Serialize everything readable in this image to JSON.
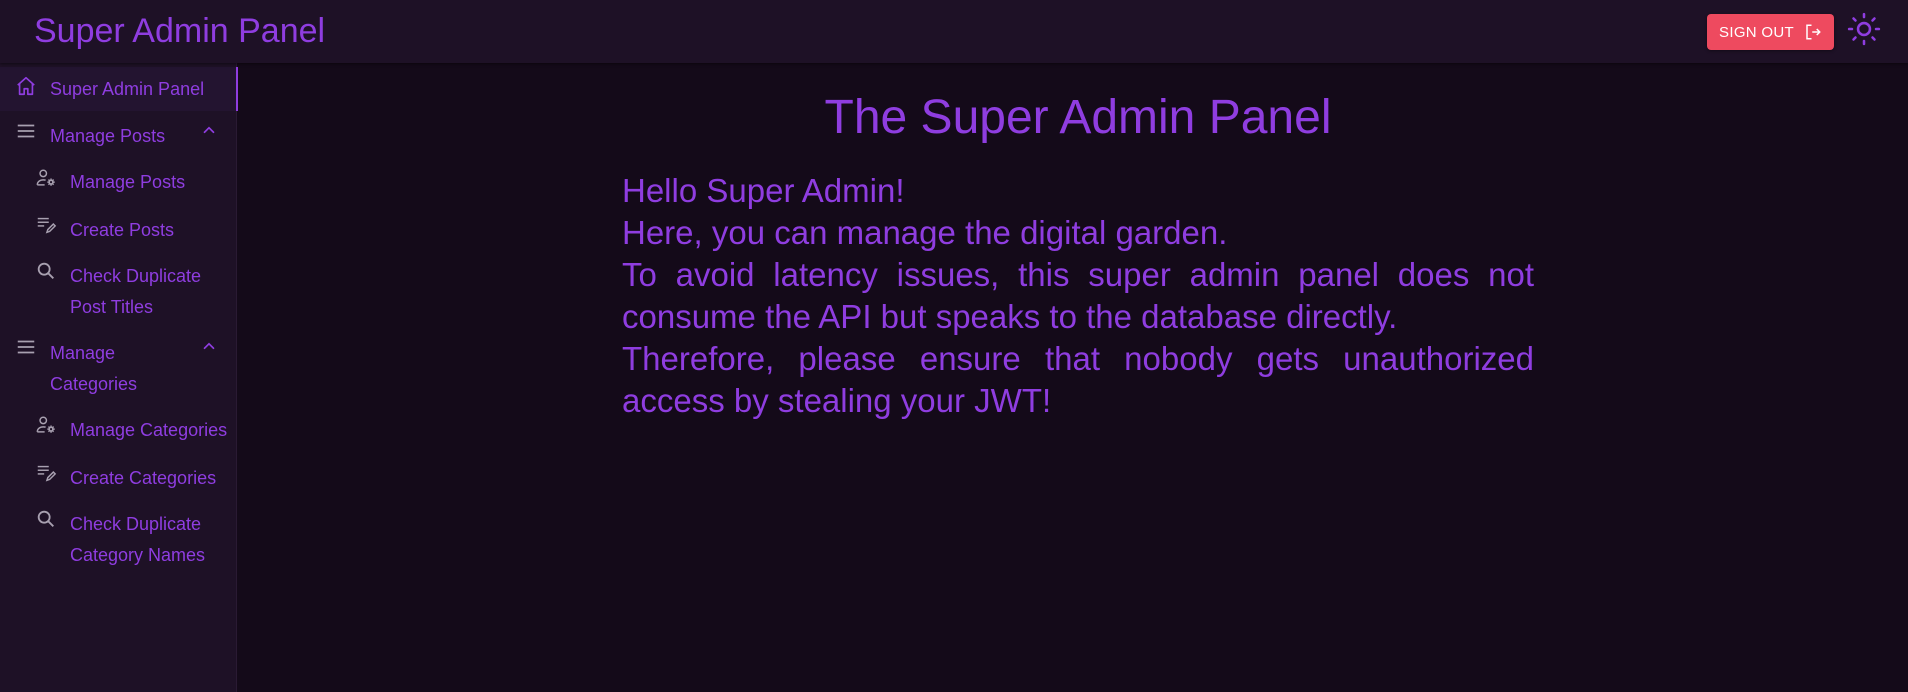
{
  "header": {
    "title": "Super Admin Panel",
    "signout_label": "SIGN OUT",
    "signout_icon": "logout-icon",
    "theme_icon": "sun-icon"
  },
  "sidebar": {
    "items": [
      {
        "label": "Super Admin Panel",
        "icon": "home-icon",
        "active": true
      },
      {
        "label": "Manage Posts",
        "icon": "menu-icon",
        "expanded": true
      },
      {
        "label": "Manage Posts",
        "icon": "manage-accounts-icon"
      },
      {
        "label": "Create Posts",
        "icon": "edit-note-icon"
      },
      {
        "label": "Check Duplicate Post Titles",
        "icon": "search-icon"
      },
      {
        "label": "Manage Categories",
        "icon": "menu-icon",
        "expanded": true
      },
      {
        "label": "Manage Categories",
        "icon": "manage-accounts-icon"
      },
      {
        "label": "Create Categories",
        "icon": "edit-note-icon"
      },
      {
        "label": "Check Duplicate Category Names",
        "icon": "search-icon"
      }
    ]
  },
  "main": {
    "title": "The Super Admin Panel",
    "paragraphs": [
      "Hello Super Admin!",
      "Here, you can manage the digital garden.",
      "To avoid latency issues, this super admin panel does not consume the API but speaks to the database directly.",
      "Therefore, please ensure that nobody gets unauthorized access by stealing your JWT!"
    ]
  },
  "colors": {
    "accent": "#8f3de0",
    "background": "#140a19",
    "surface": "#1e1126",
    "signout": "#ee4a5f",
    "icon": "#a8a0b0"
  }
}
